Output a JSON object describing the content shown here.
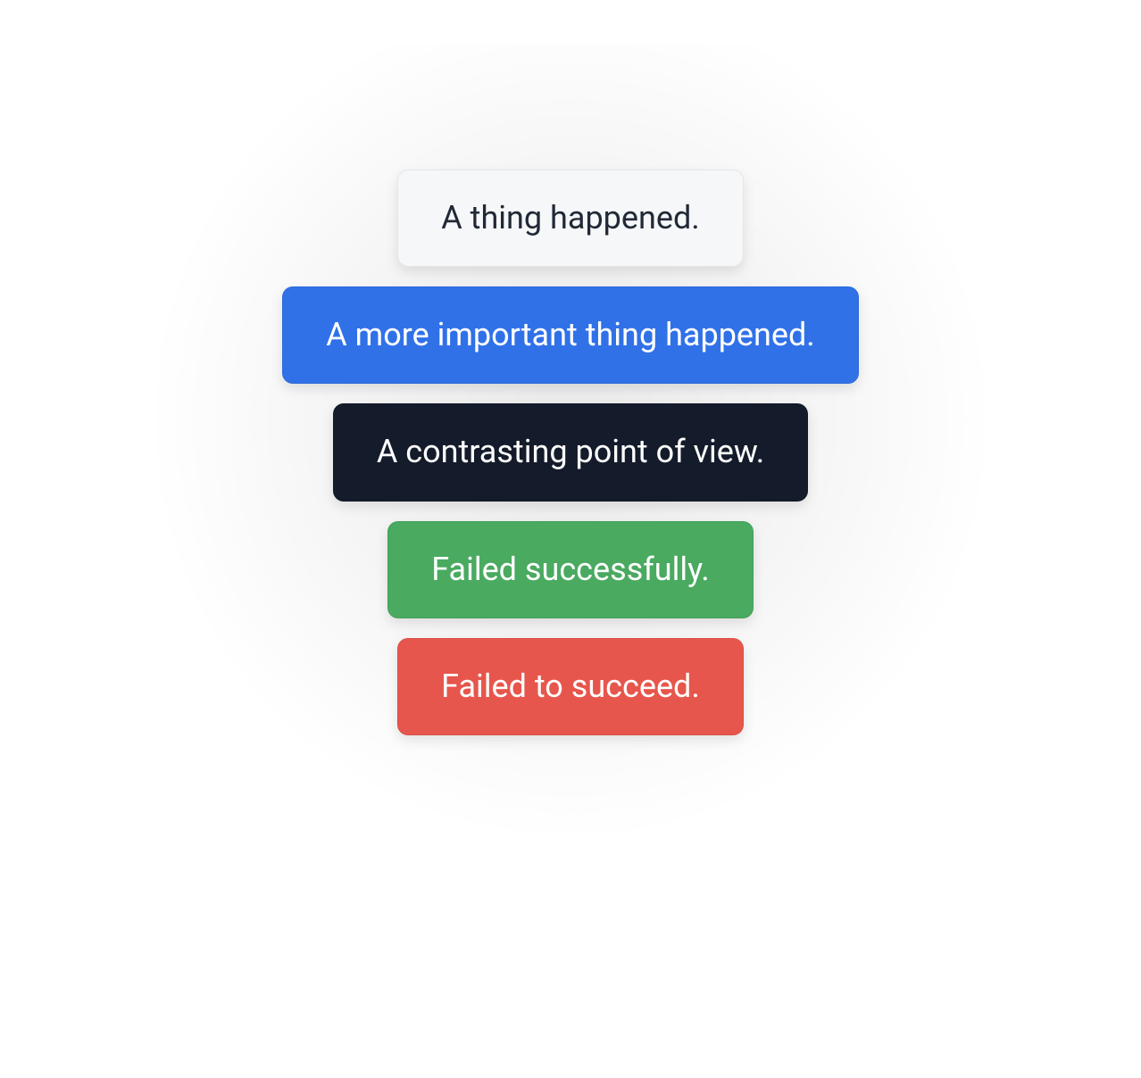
{
  "alerts": [
    {
      "variant": "light",
      "text": "A thing happened."
    },
    {
      "variant": "primary",
      "text": "A more important thing happened."
    },
    {
      "variant": "dark",
      "text": "A contrasting point of view."
    },
    {
      "variant": "success",
      "text": "Failed successfully."
    },
    {
      "variant": "danger",
      "text": "Failed to succeed."
    }
  ],
  "colors": {
    "light_bg": "#f6f7f8",
    "light_text": "#212937",
    "primary": "#3071e8",
    "dark": "#141c2b",
    "success": "#49aa60",
    "danger": "#e7564c"
  }
}
